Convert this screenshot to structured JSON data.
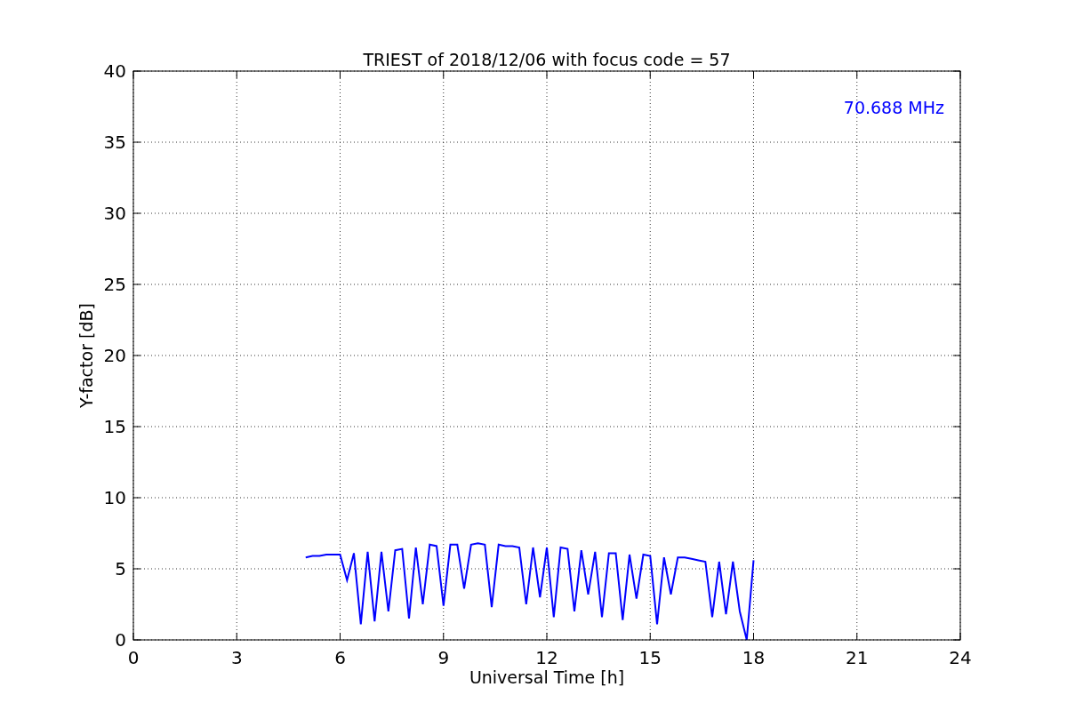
{
  "figure": {
    "chart_data": {
      "type": "line",
      "title": "TRIEST of 2018/12/06 with focus code = 57",
      "xlabel": "Universal Time [h]",
      "ylabel": "Y-factor [dB]",
      "xlim": [
        0,
        24
      ],
      "ylim": [
        0,
        40
      ],
      "xticks": [
        0,
        3,
        6,
        9,
        12,
        15,
        18,
        21,
        24
      ],
      "yticks": [
        0,
        5,
        10,
        15,
        20,
        25,
        30,
        35,
        40
      ],
      "x": [
        5.0,
        5.2,
        5.4,
        5.6,
        5.8,
        6.0,
        6.2,
        6.4,
        6.6,
        6.8,
        7.0,
        7.2,
        7.4,
        7.6,
        7.8,
        8.0,
        8.2,
        8.4,
        8.6,
        8.8,
        9.0,
        9.2,
        9.4,
        9.6,
        9.8,
        10.0,
        10.2,
        10.4,
        10.6,
        10.8,
        11.0,
        11.2,
        11.4,
        11.6,
        11.8,
        12.0,
        12.2,
        12.4,
        12.6,
        12.8,
        13.0,
        13.2,
        13.4,
        13.6,
        13.8,
        14.0,
        14.2,
        14.4,
        14.6,
        14.8,
        15.0,
        15.2,
        15.4,
        15.6,
        15.8,
        16.0,
        16.2,
        16.4,
        16.6,
        16.8,
        17.0,
        17.2,
        17.4,
        17.6,
        17.8,
        18.0
      ],
      "series": [
        {
          "color": "#0000ff",
          "values": [
            5.8,
            5.9,
            5.9,
            6.0,
            6.0,
            6.0,
            4.2,
            6.1,
            1.1,
            6.2,
            1.3,
            6.2,
            2.0,
            6.3,
            6.4,
            1.5,
            6.5,
            2.5,
            6.7,
            6.6,
            2.4,
            6.7,
            6.7,
            3.6,
            6.7,
            6.8,
            6.7,
            2.3,
            6.7,
            6.6,
            6.6,
            6.5,
            2.5,
            6.5,
            3.0,
            6.5,
            1.6,
            6.5,
            6.4,
            2.0,
            6.3,
            3.2,
            6.2,
            1.6,
            6.1,
            6.1,
            1.4,
            6.0,
            2.9,
            6.0,
            5.9,
            1.1,
            5.8,
            3.2,
            5.8,
            5.8,
            5.7,
            5.6,
            5.5,
            1.6,
            5.5,
            1.8,
            5.5,
            2.0,
            0.0,
            5.6
          ]
        }
      ],
      "grid": true,
      "annotations": [
        {
          "text": "70.688 MHz"
        }
      ]
    }
  }
}
